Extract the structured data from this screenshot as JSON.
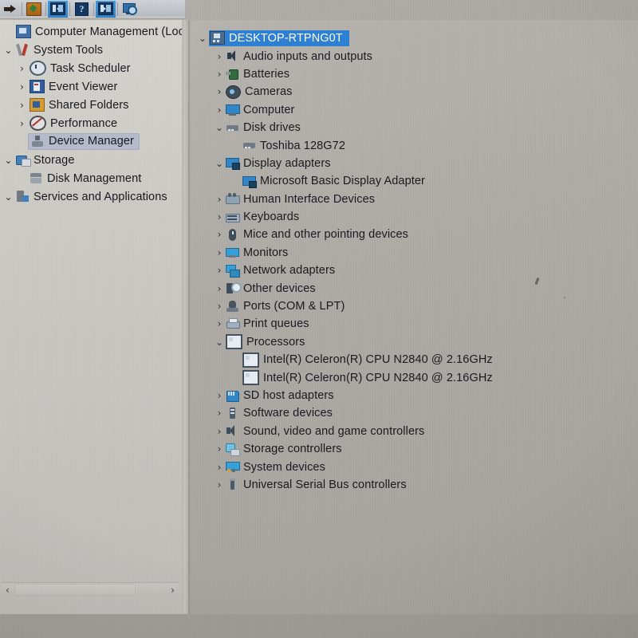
{
  "app": {
    "title": "Computer Management",
    "window_kind": "mmc-console"
  },
  "toolbar": {
    "buttons": [
      {
        "name": "forward-button",
        "icon": "forward-arrow-icon",
        "label": "Forward",
        "active": false
      },
      {
        "name": "export-list-button",
        "icon": "export-folder-icon",
        "label": "Export List",
        "active": false
      },
      {
        "name": "show-hide-console-tree-button",
        "icon": "console-tree-panel-icon",
        "label": "Show/Hide Console Tree",
        "active": true
      },
      {
        "name": "help-button",
        "icon": "question-mark-icon",
        "label": "Help",
        "active": false
      },
      {
        "name": "show-hide-action-pane-button",
        "icon": "action-pane-panel-icon",
        "label": "Show/Hide Action Pane",
        "active": true
      },
      {
        "name": "scan-hardware-changes-button",
        "icon": "scan-monitor-magnifier-icon",
        "label": "Scan for hardware changes",
        "active": false
      }
    ]
  },
  "console_tree": {
    "scrollbar": {
      "left_arrow": "‹",
      "right_arrow": "›"
    },
    "items": [
      {
        "label": "Computer Management (Local",
        "icon": "computer-management-icon",
        "indent": 0,
        "chevron": "",
        "selected": false
      },
      {
        "label": "System Tools",
        "icon": "system-tools-icon",
        "indent": 0,
        "chevron": "⌄",
        "selected": false
      },
      {
        "label": "Task Scheduler",
        "icon": "clock-icon",
        "indent": 1,
        "chevron": "›",
        "selected": false
      },
      {
        "label": "Event Viewer",
        "icon": "event-viewer-icon",
        "indent": 1,
        "chevron": "›",
        "selected": false
      },
      {
        "label": "Shared Folders",
        "icon": "shared-folders-icon",
        "indent": 1,
        "chevron": "›",
        "selected": false
      },
      {
        "label": "Performance",
        "icon": "performance-icon",
        "indent": 1,
        "chevron": "›",
        "selected": false
      },
      {
        "label": "Device Manager",
        "icon": "device-manager-icon",
        "indent": 1,
        "chevron": "",
        "selected": true
      },
      {
        "label": "Storage",
        "icon": "storage-icon",
        "indent": 0,
        "chevron": "⌄",
        "selected": false
      },
      {
        "label": "Disk Management",
        "icon": "disk-management-icon",
        "indent": 1,
        "chevron": "",
        "selected": false
      },
      {
        "label": "Services and Applications",
        "icon": "services-applications-icon",
        "indent": 0,
        "chevron": "⌄",
        "selected": false
      }
    ]
  },
  "device_tree": {
    "items": [
      {
        "label": "DESKTOP-RTPNG0T",
        "icon": "computer-node-icon",
        "indent": 0,
        "chevron": "⌄",
        "selected": true
      },
      {
        "label": "Audio inputs and outputs",
        "icon": "speaker-icon",
        "indent": 1,
        "chevron": "›",
        "selected": false
      },
      {
        "label": "Batteries",
        "icon": "battery-icon",
        "indent": 1,
        "chevron": "›",
        "selected": false
      },
      {
        "label": "Cameras",
        "icon": "camera-icon",
        "indent": 1,
        "chevron": "›",
        "selected": false
      },
      {
        "label": "Computer",
        "icon": "computer-icon",
        "indent": 1,
        "chevron": "›",
        "selected": false
      },
      {
        "label": "Disk drives",
        "icon": "disk-drive-icon",
        "indent": 1,
        "chevron": "⌄",
        "selected": false
      },
      {
        "label": "Toshiba 128G72",
        "icon": "disk-drive-icon",
        "indent": 2,
        "chevron": "",
        "selected": false
      },
      {
        "label": "Display adapters",
        "icon": "display-adapter-icon",
        "indent": 1,
        "chevron": "⌄",
        "selected": false
      },
      {
        "label": "Microsoft Basic Display Adapter",
        "icon": "display-adapter-icon",
        "indent": 2,
        "chevron": "",
        "selected": false
      },
      {
        "label": "Human Interface Devices",
        "icon": "hid-icon",
        "indent": 1,
        "chevron": "›",
        "selected": false
      },
      {
        "label": "Keyboards",
        "icon": "keyboard-icon",
        "indent": 1,
        "chevron": "›",
        "selected": false
      },
      {
        "label": "Mice and other pointing devices",
        "icon": "mouse-icon",
        "indent": 1,
        "chevron": "›",
        "selected": false
      },
      {
        "label": "Monitors",
        "icon": "monitor-icon",
        "indent": 1,
        "chevron": "›",
        "selected": false
      },
      {
        "label": "Network adapters",
        "icon": "network-adapter-icon",
        "indent": 1,
        "chevron": "›",
        "selected": false
      },
      {
        "label": "Other devices",
        "icon": "other-devices-icon",
        "indent": 1,
        "chevron": "›",
        "selected": false
      },
      {
        "label": "Ports (COM & LPT)",
        "icon": "port-icon",
        "indent": 1,
        "chevron": "›",
        "selected": false
      },
      {
        "label": "Print queues",
        "icon": "printer-icon",
        "indent": 1,
        "chevron": "›",
        "selected": false
      },
      {
        "label": "Processors",
        "icon": "processor-icon",
        "indent": 1,
        "chevron": "⌄",
        "selected": false
      },
      {
        "label": "Intel(R) Celeron(R) CPU  N2840  @ 2.16GHz",
        "icon": "processor-icon",
        "indent": 2,
        "chevron": "",
        "selected": false
      },
      {
        "label": "Intel(R) Celeron(R) CPU  N2840  @ 2.16GHz",
        "icon": "processor-icon",
        "indent": 2,
        "chevron": "",
        "selected": false
      },
      {
        "label": "SD host adapters",
        "icon": "sd-host-adapter-icon",
        "indent": 1,
        "chevron": "›",
        "selected": false
      },
      {
        "label": "Software devices",
        "icon": "software-device-icon",
        "indent": 1,
        "chevron": "›",
        "selected": false
      },
      {
        "label": "Sound, video and game controllers",
        "icon": "sound-controller-icon",
        "indent": 1,
        "chevron": "›",
        "selected": false
      },
      {
        "label": "Storage controllers",
        "icon": "storage-controller-icon",
        "indent": 1,
        "chevron": "›",
        "selected": false
      },
      {
        "label": "System devices",
        "icon": "system-device-icon",
        "indent": 1,
        "chevron": "›",
        "selected": false
      },
      {
        "label": "Universal Serial Bus controllers",
        "icon": "usb-controller-icon",
        "indent": 1,
        "chevron": "›",
        "selected": false
      }
    ]
  },
  "colors": {
    "selection_active": "#2a7fd4",
    "selection_inactive": "#b6bccb",
    "toolbar_active": "#3d9ade",
    "pane_background": "#aeaba6",
    "text": "#15171d"
  }
}
